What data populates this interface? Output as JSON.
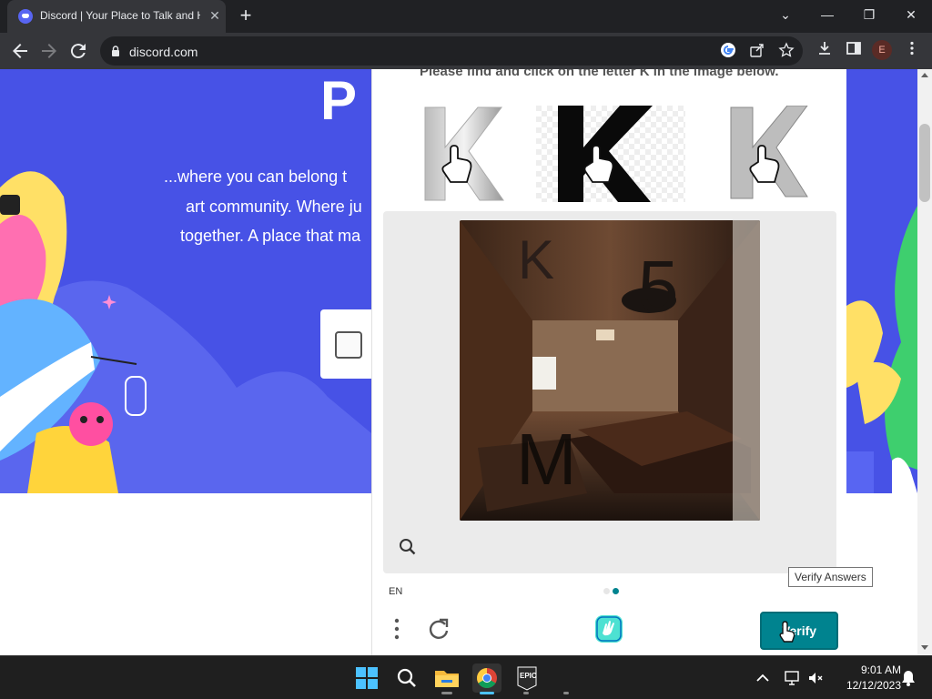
{
  "browser": {
    "tab_title": "Discord | Your Place to Talk and H",
    "tab_close": "✕",
    "new_tab": "+",
    "url": "discord.com",
    "profile_initial": "E",
    "window_controls": {
      "dropdown": "⌄",
      "minimize": "—",
      "restore": "❐",
      "close": "✕"
    }
  },
  "hero": {
    "title_partial": "P",
    "lines": [
      "...where you can belong t",
      "art community. Where ju",
      "together. A place that ma"
    ],
    "background_color": "#4752e6"
  },
  "captcha": {
    "prompt": "Please find and click on the letter K in the image below.",
    "example_letter": "K",
    "main_image_letters": [
      "K",
      "5",
      "M"
    ],
    "language": "EN",
    "page_dots": 2,
    "active_dot": 2,
    "verify_label": "Verify",
    "tooltip": "Verify Answers",
    "accent_color": "#00838f"
  },
  "taskbar": {
    "time": "9:01 AM",
    "date": "12/12/2023",
    "apps": [
      "windows-start",
      "search",
      "file-explorer",
      "chrome",
      "epic-games"
    ],
    "active_app": "chrome"
  }
}
